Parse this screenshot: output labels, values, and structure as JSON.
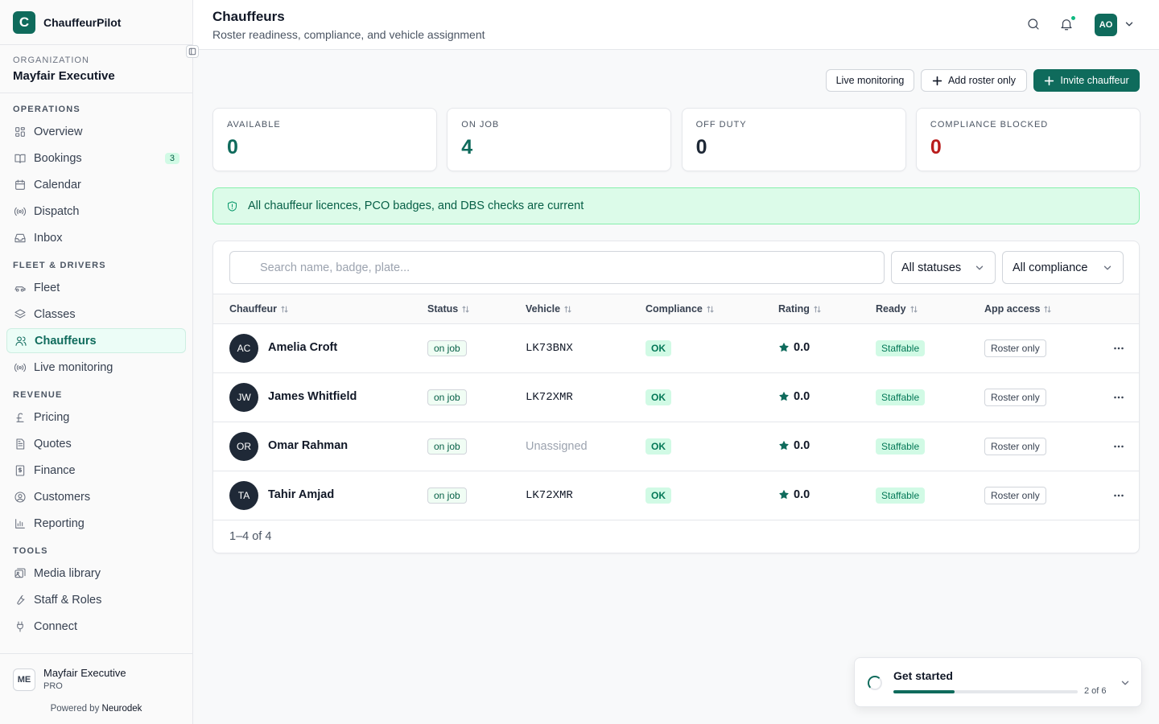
{
  "brand": {
    "name": "ChauffeurPilot",
    "logo_letter": "C"
  },
  "organization": {
    "label": "ORGANIZATION",
    "name": "Mayfair Executive"
  },
  "nav": [
    {
      "section": "OPERATIONS",
      "items": [
        {
          "label": "Overview",
          "icon": "grid-icon"
        },
        {
          "label": "Bookings",
          "icon": "book-icon",
          "badge": "3"
        },
        {
          "label": "Calendar",
          "icon": "calendar-icon"
        },
        {
          "label": "Dispatch",
          "icon": "broadcast-icon"
        },
        {
          "label": "Inbox",
          "icon": "inbox-icon"
        }
      ]
    },
    {
      "section": "FLEET & DRIVERS",
      "items": [
        {
          "label": "Fleet",
          "icon": "car-icon"
        },
        {
          "label": "Classes",
          "icon": "layers-icon"
        },
        {
          "label": "Chauffeurs",
          "icon": "users-icon",
          "active": true
        },
        {
          "label": "Live monitoring",
          "icon": "broadcast-icon"
        }
      ]
    },
    {
      "section": "REVENUE",
      "items": [
        {
          "label": "Pricing",
          "icon": "pound-icon"
        },
        {
          "label": "Quotes",
          "icon": "document-icon"
        },
        {
          "label": "Finance",
          "icon": "receipt-icon"
        },
        {
          "label": "Customers",
          "icon": "user-circle-icon"
        },
        {
          "label": "Reporting",
          "icon": "bar-chart-icon"
        }
      ]
    },
    {
      "section": "TOOLS",
      "items": [
        {
          "label": "Media library",
          "icon": "images-icon"
        },
        {
          "label": "Staff & Roles",
          "icon": "wrench-icon"
        },
        {
          "label": "Connect",
          "icon": "plug-icon"
        }
      ]
    }
  ],
  "account": {
    "initials": "ME",
    "name": "Mayfair Executive",
    "plan": "PRO",
    "powered_prefix": "Powered by",
    "powered_brand": "Neurodek"
  },
  "header": {
    "title": "Chauffeurs",
    "subtitle": "Roster readiness, compliance, and vehicle assignment",
    "avatar": "AO"
  },
  "actions": {
    "live": "Live monitoring",
    "add_roster": "Add roster only",
    "invite": "Invite chauffeur"
  },
  "stats": [
    {
      "label": "AVAILABLE",
      "value": "0",
      "color": "#0f6b5c"
    },
    {
      "label": "ON JOB",
      "value": "4",
      "color": "#0f6b5c"
    },
    {
      "label": "OFF DUTY",
      "value": "0",
      "color": "#1f2937"
    },
    {
      "label": "COMPLIANCE BLOCKED",
      "value": "0",
      "color": "#b91c1c"
    }
  ],
  "alert": {
    "text": "All chauffeur licences, PCO badges, and DBS checks are current"
  },
  "filters": {
    "search_placeholder": "Search name, badge, plate...",
    "status": "All statuses",
    "compliance": "All compliance"
  },
  "table": {
    "columns": [
      "Chauffeur",
      "Status",
      "Vehicle",
      "Compliance",
      "Rating",
      "Ready",
      "App access"
    ],
    "rows": [
      {
        "initials": "AC",
        "name": "Amelia Croft",
        "status": "on job",
        "vehicle": "LK73BNX",
        "compliance": "OK",
        "rating": "0.0",
        "ready": "Staffable",
        "access": "Roster only"
      },
      {
        "initials": "JW",
        "name": "James Whitfield",
        "status": "on job",
        "vehicle": "LK72XMR",
        "compliance": "OK",
        "rating": "0.0",
        "ready": "Staffable",
        "access": "Roster only"
      },
      {
        "initials": "OR",
        "name": "Omar Rahman",
        "status": "on job",
        "vehicle": "Unassigned",
        "vehicle_unassigned": true,
        "compliance": "OK",
        "rating": "0.0",
        "ready": "Staffable",
        "access": "Roster only"
      },
      {
        "initials": "TA",
        "name": "Tahir Amjad",
        "status": "on job",
        "vehicle": "LK72XMR",
        "compliance": "OK",
        "rating": "0.0",
        "ready": "Staffable",
        "access": "Roster only"
      }
    ],
    "pagination": "1–4 of 4"
  },
  "get_started": {
    "title": "Get started",
    "progress_text": "2 of 6",
    "progress": 0.333
  }
}
